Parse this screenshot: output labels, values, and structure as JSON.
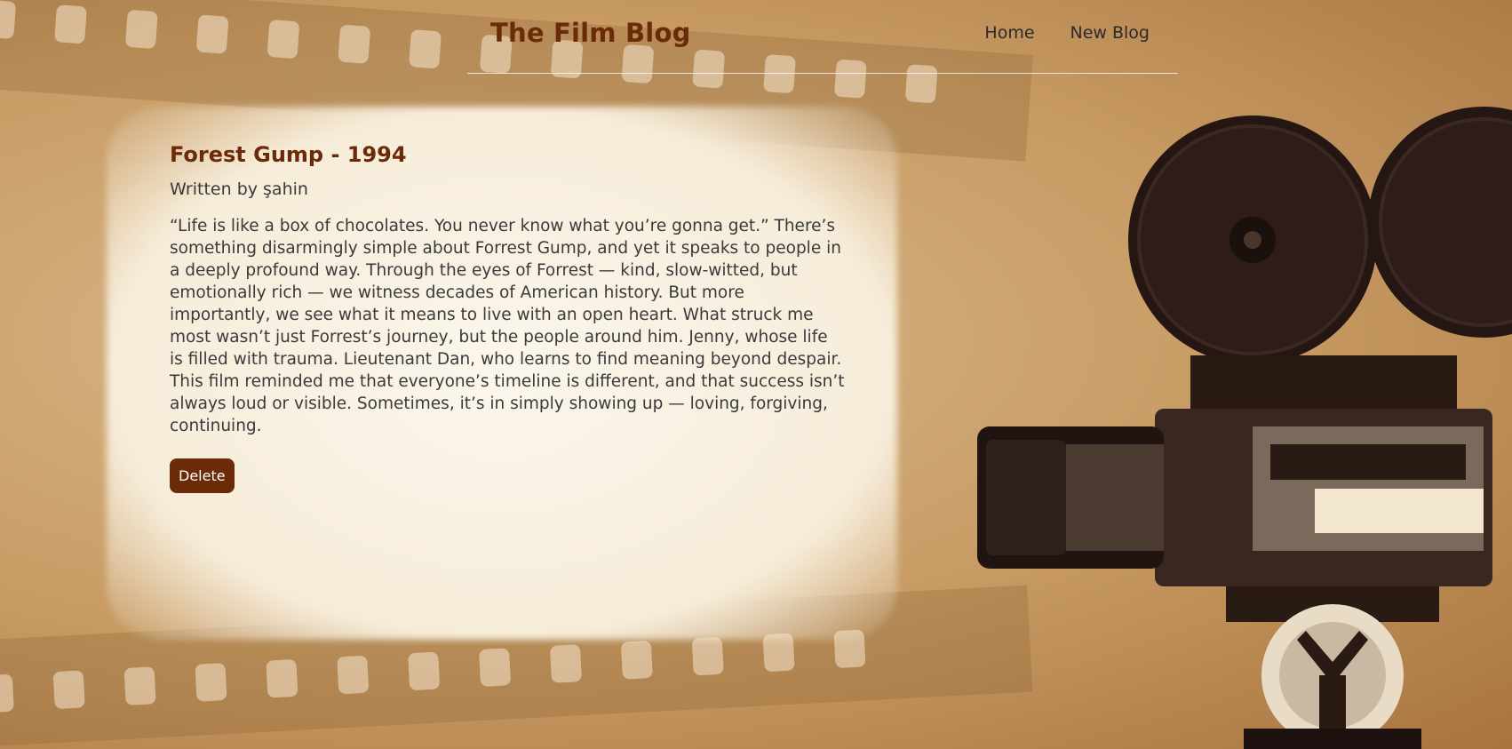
{
  "header": {
    "title": "The Film Blog",
    "nav": {
      "home": "Home",
      "new_blog": "New Blog"
    }
  },
  "post": {
    "title": "Forest Gump - 1994",
    "author": "Written by şahin",
    "body": "“Life is like a box of chocolates. You never know what you’re gonna get.” There’s something disarmingly simple about Forrest Gump, and yet it speaks to people in a deeply profound way. Through the eyes of Forrest — kind, slow-witted, but emotionally rich — we witness decades of American history. But more importantly, we see what it means to live with an open heart. What struck me most wasn’t just Forrest’s journey, but the people around him. Jenny, whose life is filled with trauma. Lieutenant Dan, who learns to find meaning beyond despair. This film reminded me that everyone’s timeline is different, and that success isn’t always loud or visible. Sometimes, it’s in simply showing up — loving, forgiving, continuing.",
    "delete_label": "Delete"
  },
  "colors": {
    "accent": "#6b2a08",
    "text": "#3a3a3a"
  },
  "background": {
    "icon": "vintage-film-camera"
  }
}
